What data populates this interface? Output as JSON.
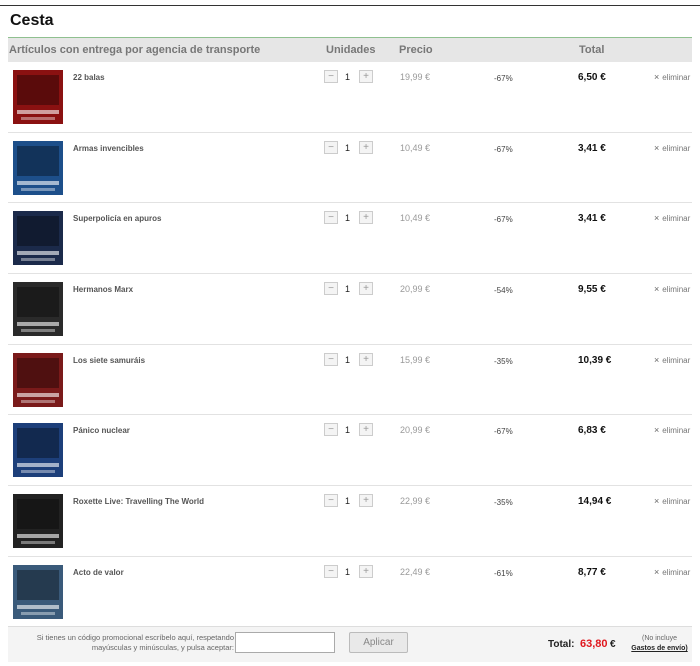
{
  "page": {
    "title": "Cesta"
  },
  "header": {
    "articles": "Artículos con entrega por agencia de transporte",
    "units": "Unidades",
    "price": "Precio",
    "total": "Total"
  },
  "controls": {
    "minus": "−",
    "plus": "+",
    "remove_icon": "×",
    "remove_label": "eliminar"
  },
  "items": [
    {
      "title": "22 balas",
      "qty": "1",
      "price": "19,99 €",
      "discount": "-67%",
      "total": "6,50 €",
      "cover_icon": "movie-cover-icon",
      "cover_color": "#8a1111"
    },
    {
      "title": "Armas invencibles",
      "qty": "1",
      "price": "10,49 €",
      "discount": "-67%",
      "total": "3,41 €",
      "cover_icon": "movie-cover-icon",
      "cover_color": "#1d4f8a"
    },
    {
      "title": "Superpolicía en apuros",
      "qty": "1",
      "price": "10,49 €",
      "discount": "-67%",
      "total": "3,41 €",
      "cover_icon": "movie-cover-icon",
      "cover_color": "#1b2a4a"
    },
    {
      "title": "Hermanos Marx",
      "qty": "1",
      "price": "20,99 €",
      "discount": "-54%",
      "total": "9,55 €",
      "cover_icon": "movie-cover-icon",
      "cover_color": "#2a2a2a"
    },
    {
      "title": "Los siete samuráis",
      "qty": "1",
      "price": "15,99 €",
      "discount": "-35%",
      "total": "10,39 €",
      "cover_icon": "movie-cover-icon",
      "cover_color": "#7a1a1a"
    },
    {
      "title": "Pánico nuclear",
      "qty": "1",
      "price": "20,99 €",
      "discount": "-67%",
      "total": "6,83 €",
      "cover_icon": "movie-cover-icon",
      "cover_color": "#1d3f7a"
    },
    {
      "title": "Roxette Live: Travelling The World",
      "qty": "1",
      "price": "22,99 €",
      "discount": "-35%",
      "total": "14,94 €",
      "cover_icon": "movie-cover-icon",
      "cover_color": "#222222"
    },
    {
      "title": "Acto de valor",
      "qty": "1",
      "price": "22,49 €",
      "discount": "-61%",
      "total": "8,77 €",
      "cover_icon": "movie-cover-icon",
      "cover_color": "#3a5a7a"
    }
  ],
  "footer": {
    "promo_text": "Si tienes un código promocional escríbelo aquí, respetando mayúsculas y minúsculas, y pulsa aceptar:",
    "promo_value": "",
    "apply_label": "Aplicar",
    "total_label": "Total:",
    "total_value": "63,80",
    "total_currency": "€",
    "shipping_note": "(No incluye",
    "shipping_link": "Gastos de envío)"
  },
  "colors": {
    "accent_red": "#e0161d",
    "header_bg": "#e6e6e6",
    "header_rule": "#8fc08f"
  }
}
